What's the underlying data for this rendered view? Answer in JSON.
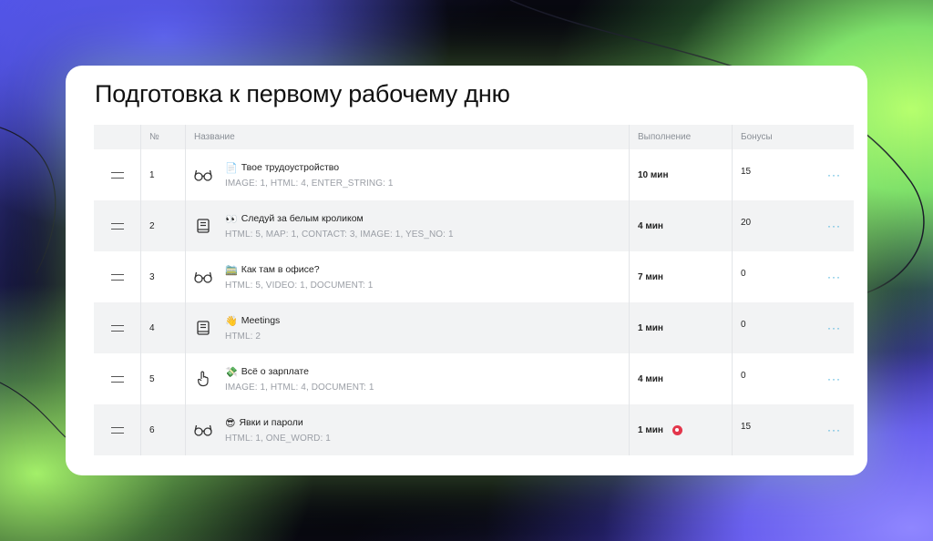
{
  "page": {
    "title": "Подготовка к первому рабочему дню"
  },
  "table": {
    "headers": {
      "num": "№",
      "name": "Название",
      "exec": "Выполнение",
      "bonus": "Бонусы"
    },
    "rows": [
      {
        "num": "1",
        "type_icon": "glasses-icon",
        "emoji": "📄",
        "name": "Твое трудоустройство",
        "meta": "IMAGE: 1, HTML: 4, ENTER_STRING: 1",
        "exec": "10 мин",
        "bonus": "15",
        "alert": false
      },
      {
        "num": "2",
        "type_icon": "book-icon",
        "emoji": "👀",
        "name": "Следуй за белым кроликом",
        "meta": "HTML: 5, MAP: 1, CONTACT: 3, IMAGE: 1, YES_NO: 1",
        "exec": "4 мин",
        "bonus": "20",
        "alert": false
      },
      {
        "num": "3",
        "type_icon": "glasses-icon",
        "emoji": "🚞",
        "name": "Как там в офисе?",
        "meta": "HTML: 5, VIDEO: 1, DOCUMENT: 1",
        "exec": "7 мин",
        "bonus": "0",
        "alert": false
      },
      {
        "num": "4",
        "type_icon": "book-icon",
        "emoji": "👋",
        "name": "Meetings",
        "meta": "HTML: 2",
        "exec": "1 мин",
        "bonus": "0",
        "alert": false
      },
      {
        "num": "5",
        "type_icon": "pointer-icon",
        "emoji": "💸",
        "name": "Всё о зарплате",
        "meta": "IMAGE: 1, HTML: 4, DOCUMENT: 1",
        "exec": "4 мин",
        "bonus": "0",
        "alert": false
      },
      {
        "num": "6",
        "type_icon": "glasses-icon",
        "emoji": "😎",
        "name": "Явки и пароли",
        "meta": "HTML: 1, ONE_WORD: 1",
        "exec": "1 мин",
        "bonus": "15",
        "alert": true
      }
    ],
    "more_label": "···"
  },
  "colors": {
    "accent_more": "#39a9d8",
    "alert": "#e3364b",
    "header_bg": "#f2f3f4"
  }
}
